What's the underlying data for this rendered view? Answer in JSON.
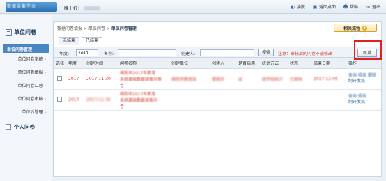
{
  "header": {
    "logo_text": "数据采集平台",
    "greeting": "晚上好！",
    "greeting_name": "用户名",
    "actions": [
      {
        "label": "换肤",
        "icon": "palette-icon"
      },
      {
        "label": "返回桌面",
        "icon": "desktop-icon"
      },
      {
        "label": "帮助",
        "icon": "help-icon"
      },
      {
        "label": "退出",
        "icon": "logout-icon"
      }
    ]
  },
  "sidebar": {
    "section_title": "单位问卷",
    "active_item": "单位问卷管理",
    "items": [
      {
        "label": "单位问卷宽统"
      },
      {
        "label": "单位问卷填报"
      },
      {
        "label": "单位问卷汇总"
      },
      {
        "label": "单位问卷审核"
      },
      {
        "label": "单位后管理"
      }
    ],
    "section2_title": "个人问卷"
  },
  "main": {
    "breadcrumb": [
      "数据问卷填报",
      "单位问卷",
      "单位问卷管理"
    ],
    "related_button": "相关流程",
    "tabs": [
      {
        "label": "未结束"
      },
      {
        "label": "已结束"
      }
    ],
    "filters": {
      "year_label": "年度:",
      "year_value": "2017",
      "name_label": "名称:",
      "name_value": "",
      "creator_label": "创建人:",
      "creator_value": ""
    },
    "search_button": "搜索",
    "note": "注意：审核后的问卷不能修改",
    "new_button": "新增"
  },
  "table": {
    "columns": [
      "选择",
      "年度",
      "创建时间",
      "问卷名称",
      "创建单位",
      "创建人",
      "是否启用",
      "统计方式",
      "状态",
      "结束日期",
      "操作"
    ],
    "rows": [
      {
        "year": "2017",
        "created": "2017-11-30",
        "name_line1": "绵阳市2017年教育",
        "name_line2": "系统基础数据调查问卷",
        "name_line3": "卷",
        "unit": "绵阳市教育局",
        "creator": "管理员",
        "enabled": "是",
        "method": "按学校统计",
        "status": "已审核",
        "end_date": "2017-12-05",
        "op1": "查询 修改 删除",
        "op2": "制开发流"
      },
      {
        "year": "2017",
        "created": "2017-11-30",
        "name_line1": "绵阳市2017年教育",
        "name_line2": "系统基础数据调查问",
        "name_line3": "卷",
        "unit": "",
        "creator": "",
        "enabled": "",
        "method": "",
        "status": "",
        "end_date": "",
        "op1": "查询 修改",
        "op2": "制开发流"
      }
    ]
  },
  "colors": {
    "accent": "#4a86c4",
    "highlight_box": "#e02020",
    "note": "#d9362b"
  }
}
